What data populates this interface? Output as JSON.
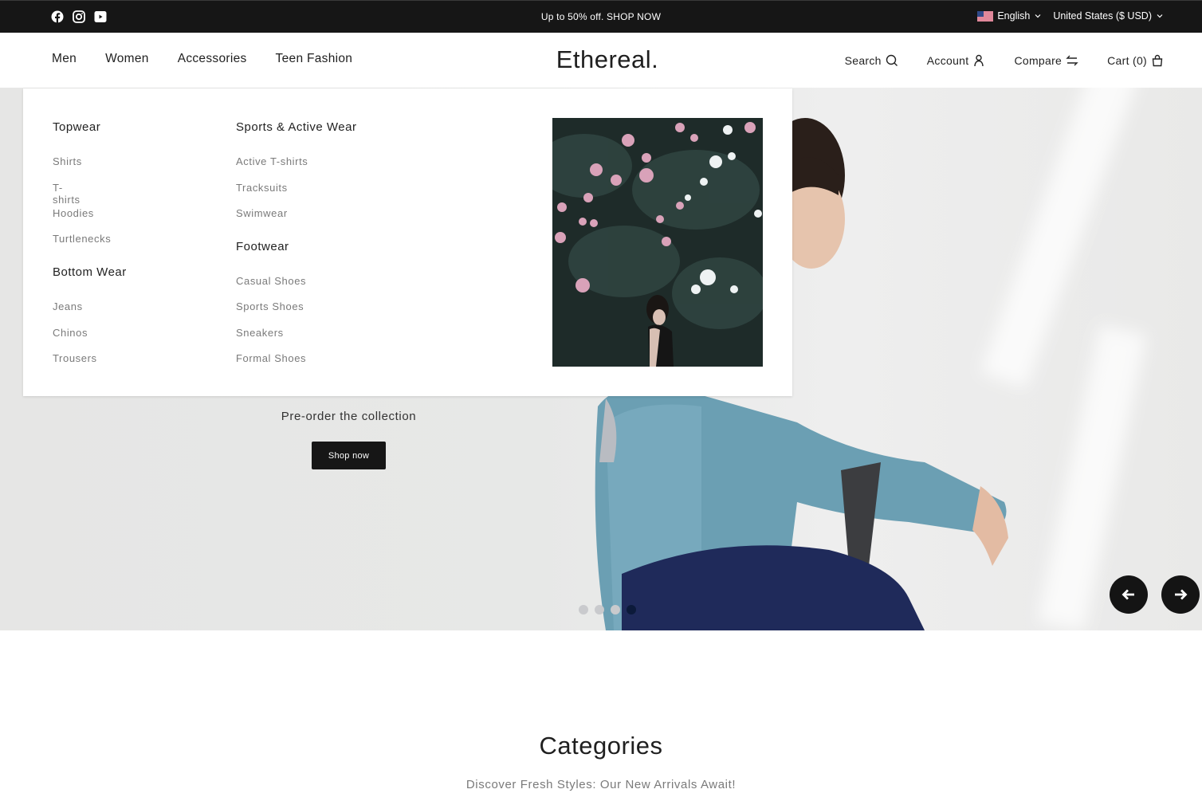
{
  "topbar": {
    "social": [
      {
        "name": "facebook-icon"
      },
      {
        "name": "instagram-icon"
      },
      {
        "name": "youtube-icon"
      }
    ],
    "announcement": "Up to 50% off. SHOP NOW",
    "language": {
      "label": "English",
      "flag": "us-flag-icon"
    },
    "currency": {
      "label": "United States ($ USD)"
    }
  },
  "header": {
    "nav": [
      "Men",
      "Women",
      "Accessories",
      "Teen Fashion"
    ],
    "logo": "Ethereal.",
    "actions": {
      "search": "Search",
      "account": "Account",
      "compare": "Compare",
      "cart": "Cart (0)"
    }
  },
  "mega_menu": {
    "col1": [
      {
        "heading": "Topwear",
        "items": [
          "Shirts",
          "T-shirts",
          "Hoodies",
          "Turtlenecks"
        ]
      },
      {
        "heading": "Bottom Wear",
        "items": [
          "Jeans",
          "Chinos",
          "Trousers"
        ]
      }
    ],
    "col2": [
      {
        "heading": "Sports & Active Wear",
        "items": [
          "Active T-shirts",
          "Tracksuits",
          "Swimwear"
        ]
      },
      {
        "heading": "Footwear",
        "items": [
          "Casual Shoes",
          "Sports Shoes",
          "Sneakers",
          "Formal Shoes"
        ]
      }
    ],
    "image_alt": "Woman standing in front of flowering oleander bush"
  },
  "hero": {
    "subtitle": "Pre-order the collection",
    "button": "Shop now",
    "slides_total": 4,
    "active_slide": 4,
    "prev_label": "Previous slide",
    "next_label": "Next slide"
  },
  "categories": {
    "title": "Categories",
    "subtitle": "Discover Fresh Styles: Our New Arrivals Await!"
  },
  "colors": {
    "topbar_bg": "#161616",
    "button_bg": "#161616",
    "active_dot": "#0c1a3a",
    "inactive_dot": "#c9cacd",
    "muted_text": "#7a7a7a"
  }
}
